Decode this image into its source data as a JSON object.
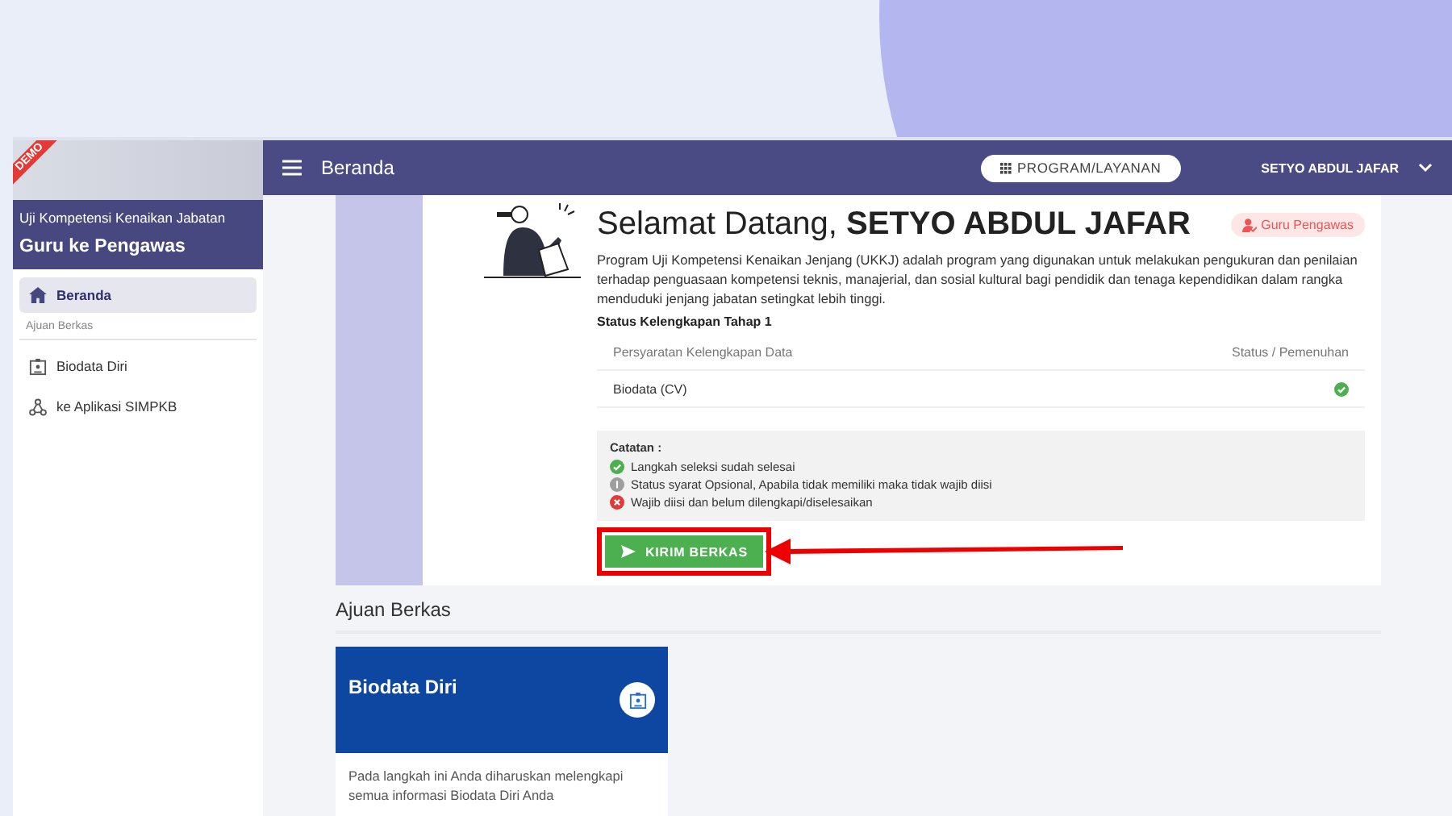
{
  "sidebar": {
    "ribbon": "DEMO",
    "subtitle": "Uji Kompetensi Kenaikan Jabatan",
    "title": "Guru ke Pengawas",
    "main_items": [
      {
        "label": "Beranda",
        "selected": true
      }
    ],
    "section_label": "Ajuan Berkas",
    "section_items": [
      {
        "label": "Biodata Diri",
        "selected": false
      },
      {
        "label": "ke Aplikasi SIMPKB",
        "selected": false
      }
    ]
  },
  "header": {
    "title": "Beranda",
    "program_button": "PROGRAM/LAYANAN",
    "user": "SETYO ABDUL JAFAR"
  },
  "welcome": {
    "greeting": "Selamat Datang, **SETYO ABDUL JAFAR**",
    "role_badge": "Guru Pengawas",
    "description": "Program Uji Kompetensi Kenaikan Jenjang (UKKJ) adalah program yang digunakan untuk melakukan pengukuran dan penilaian terhadap penguasaan kompetensi teknis, manajerial, dan sosial kultural bagi pendidik dan tenaga kependidikan dalam rangka menduduki jenjang jabatan setingkat lebih tinggi.",
    "status_title": "Status Kelengkapan Tahap 1",
    "table": {
      "columns": [
        "Persyaratan Kelengkapan Data",
        "Status / Pemenuhan"
      ],
      "rows": [
        {
          "item": "Biodata (CV)",
          "complete": true
        }
      ]
    },
    "notes": {
      "title": "Catatan :",
      "items": [
        {
          "kind": "complete",
          "text": "Langkah seleksi sudah selesai"
        },
        {
          "kind": "optional",
          "text": "Status syarat Opsional, Apabila tidak memiliki maka tidak wajib diisi"
        },
        {
          "kind": "required",
          "text": "Wajib diisi dan belum dilengkapi/diselesaikan"
        }
      ]
    },
    "submit_button": "KIRIM BERKAS"
  },
  "ajuan": {
    "title": "Ajuan Berkas",
    "cards": [
      {
        "title": "Biodata Diri",
        "description": "Pada langkah ini Anda diharuskan melengkapi semua informasi Biodata Diri Anda"
      }
    ]
  }
}
